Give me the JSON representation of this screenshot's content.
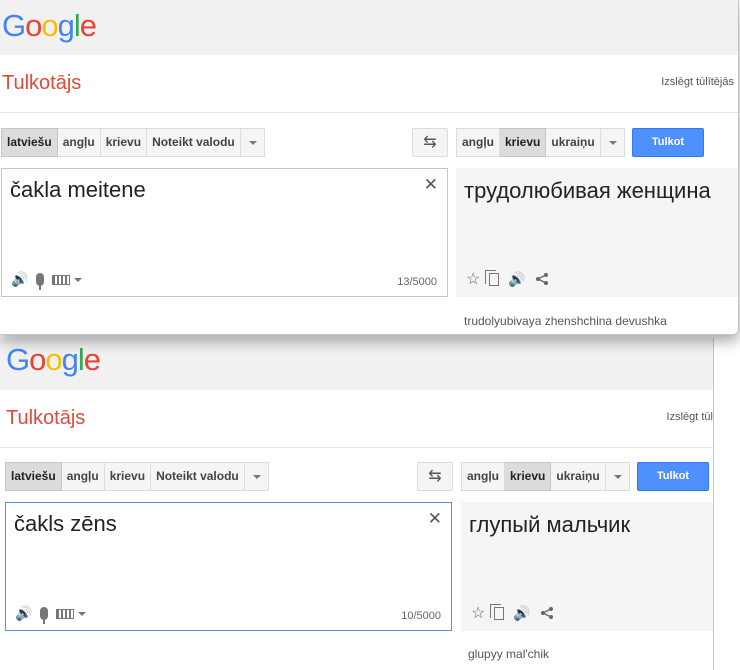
{
  "panels": [
    {
      "logo": [
        "G",
        "o",
        "o",
        "g",
        "l",
        "e"
      ],
      "title": "Tulkotājs",
      "instant_toggle": "Izslēgt tūlītējās",
      "source_langs": [
        "latviešu",
        "angļu",
        "krievu",
        "Noteikt valodu"
      ],
      "source_selected": "latviešu",
      "target_langs": [
        "angļu",
        "krievu",
        "ukraiņu"
      ],
      "target_selected": "krievu",
      "translate_label": "Tulkot",
      "source_text": "čakla meitene",
      "char_count": "13/5000",
      "result_text": "трудолюбивая женщина",
      "transliteration": "trudolyubivaya zhenshchina devushka"
    },
    {
      "logo": [
        "G",
        "o",
        "o",
        "g",
        "l",
        "e"
      ],
      "title": "Tulkotājs",
      "instant_toggle": "Izslēgt tūl",
      "source_langs": [
        "latviešu",
        "angļu",
        "krievu",
        "Noteikt valodu"
      ],
      "source_selected": "latviešu",
      "target_langs": [
        "angļu",
        "krievu",
        "ukraiņu"
      ],
      "target_selected": "krievu",
      "translate_label": "Tulkot",
      "source_text": "čakls zēns",
      "char_count": "10/5000",
      "result_text": "глупый мальчик",
      "transliteration": "glupyy mal'chik"
    }
  ],
  "icons": {
    "clear": "✕",
    "speaker": "🔊",
    "swap": "⇆",
    "star": "☆",
    "share": "share-icon"
  },
  "colors": {
    "title_red": "#dd4b39",
    "button_blue": "#4d90fe",
    "header_gray": "#f1f1f1",
    "logo": [
      "#4285f4",
      "#ea4335",
      "#fbbc05",
      "#4285f4",
      "#34a853",
      "#ea4335"
    ]
  }
}
